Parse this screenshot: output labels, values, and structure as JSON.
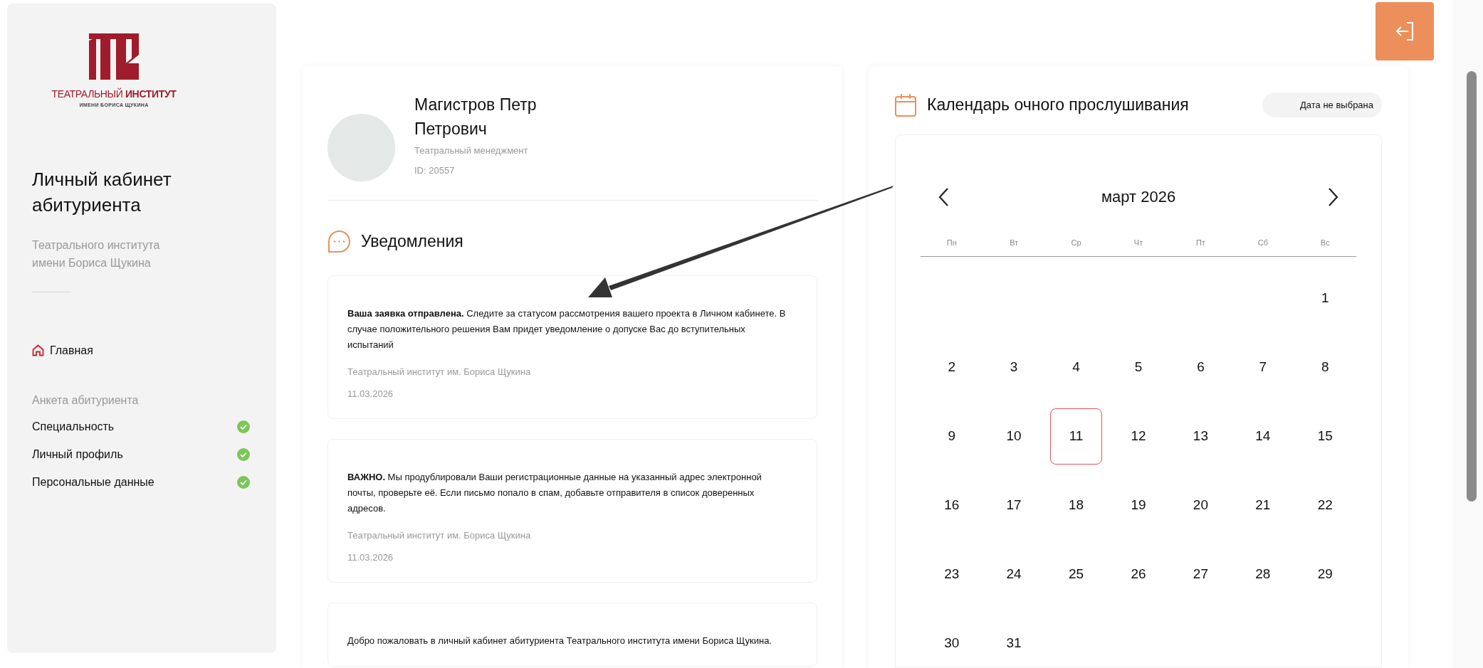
{
  "sidebar": {
    "logo": {
      "line_1": "ТЕАТРАЛЬНЫЙ **ИНСТИТУТ**",
      "line_2": "ИМЕНИ БОРИСА ЩУКИНА"
    },
    "title": "Личный кабинет абитуриента",
    "subtitle": "Театрального института имени Бориса Щукина",
    "nav": [
      {
        "label": "Главная",
        "selected": true
      }
    ],
    "section_label": "Анкета абитуриента",
    "items": [
      {
        "label": "Специальность",
        "completed": true
      },
      {
        "label": "Личный профиль",
        "completed": true
      },
      {
        "label": "Персональные данные",
        "completed": true
      }
    ]
  },
  "profile": {
    "name": "Магистров Петр Петрович",
    "program": "Театральный менеджмент",
    "id": "ID: 20557"
  },
  "notifications": {
    "title": "Уведомления",
    "items": [
      {
        "text": "**Ваша заявка отправлена.** Следите за статусом рассмотрения вашего проекта в Личном кабинете. В случае положительного решения Вам придет уведомление о допуске Вас до вступительных испытаний",
        "source": "Театральный институт им. Бориса Щукина",
        "date": "11.03.2026"
      },
      {
        "text": "**ВАЖНО.** Мы продублировали Ваши регистрационные данные на указанный адрес электронной почты, проверьте её. Если письмо попало в спам, добавьте отправителя в список доверенных адресов.",
        "source": "Театральный институт им. Бориса Щукина",
        "date": "11.03.2026"
      },
      {
        "text": "Добро пожаловать в личный кабинет абитуриента Театрального института имени Бориса Щукина."
      }
    ]
  },
  "calendar": {
    "title": "Календарь очного прослушивания",
    "badge": "Дата не выбрана",
    "month": "март 2026",
    "weekdays": [
      "Пн",
      "Вт",
      "Ср",
      "Чт",
      "Пт",
      "Сб",
      "Вс"
    ],
    "weeks": [
      {
        "right_aligned": true,
        "days": [
          {
            "day": "1",
            "selected": false
          }
        ]
      },
      {
        "days": [
          {
            "day": "2",
            "selected": false
          },
          {
            "day": "3",
            "selected": false
          },
          {
            "day": "4",
            "selected": false
          },
          {
            "day": "5",
            "selected": false
          },
          {
            "day": "6",
            "selected": false
          },
          {
            "day": "7",
            "selected": false
          },
          {
            "day": "8",
            "selected": false
          }
        ]
      },
      {
        "days": [
          {
            "day": "9",
            "selected": false
          },
          {
            "day": "10",
            "selected": false
          },
          {
            "day": "11",
            "selected": true
          },
          {
            "day": "12",
            "selected": false
          },
          {
            "day": "13",
            "selected": false
          },
          {
            "day": "14",
            "selected": false
          },
          {
            "day": "15",
            "selected": false
          }
        ]
      },
      {
        "days": [
          {
            "day": "16",
            "selected": false
          },
          {
            "day": "17",
            "selected": false
          },
          {
            "day": "18",
            "selected": false
          },
          {
            "day": "19",
            "selected": false
          },
          {
            "day": "20",
            "selected": false
          },
          {
            "day": "21",
            "selected": false
          },
          {
            "day": "22",
            "selected": false
          }
        ]
      },
      {
        "days": [
          {
            "day": "23",
            "selected": false
          },
          {
            "day": "24",
            "selected": false
          },
          {
            "day": "25",
            "selected": false
          },
          {
            "day": "26",
            "selected": false
          },
          {
            "day": "27",
            "selected": false
          },
          {
            "day": "28",
            "selected": false
          },
          {
            "day": "29",
            "selected": false
          }
        ]
      },
      {
        "days": [
          {
            "day": "30",
            "selected": false
          },
          {
            "day": "31",
            "selected": false
          }
        ]
      }
    ]
  }
}
